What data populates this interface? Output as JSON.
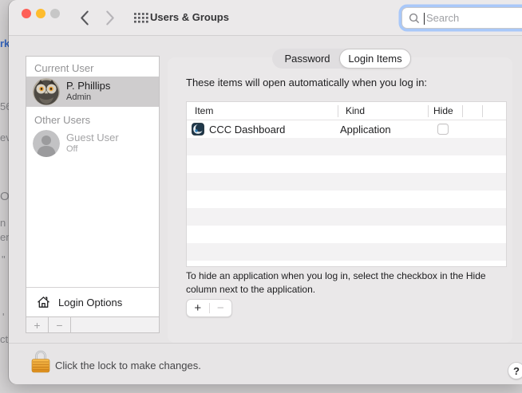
{
  "background_fragments": [
    {
      "text": "rk"
    },
    {
      "text": "56"
    },
    {
      "text": "ev"
    },
    {
      "text": "O"
    },
    {
      "text": "n ("
    },
    {
      "text": "en"
    },
    {
      "text": "\""
    },
    {
      "text": "'"
    },
    {
      "text": "ct"
    }
  ],
  "window": {
    "titlebar": {
      "title": "Users & Groups",
      "search": {
        "placeholder": "Search"
      }
    },
    "tabs": {
      "password": "Password",
      "login_items": "Login Items"
    },
    "sidebar": {
      "current_user_header": "Current User",
      "current_user": {
        "name": "P. Phillips",
        "role": "Admin"
      },
      "other_users_header": "Other Users",
      "guest_user": {
        "name": "Guest User",
        "status": "Off"
      },
      "login_options": "Login Options",
      "add": "+",
      "remove": "−"
    },
    "login_items": {
      "description": "These items will open automatically when you log in:",
      "columns": {
        "item": "Item",
        "kind": "Kind",
        "hide": "Hide"
      },
      "rows": [
        {
          "item": "CCC Dashboard",
          "kind": "Application",
          "hide_checked": false
        }
      ],
      "visible_empty_rows": 8,
      "hint": "To hide an application when you log in, select the checkbox in the Hide column next to the application.",
      "add": "+",
      "remove": "−"
    },
    "footer": {
      "lock_text": "Click the lock to make changes.",
      "help": "?"
    }
  },
  "colors": {
    "focus_ring": "#a9c8f9",
    "selected_row": "#cfcdce",
    "titlebar_bg": "#ebe9ea",
    "window_bg": "#e7e5e6",
    "lock_body": "#eda23b",
    "close_button": "#fe5f57",
    "minimize_button": "#febc2e"
  }
}
